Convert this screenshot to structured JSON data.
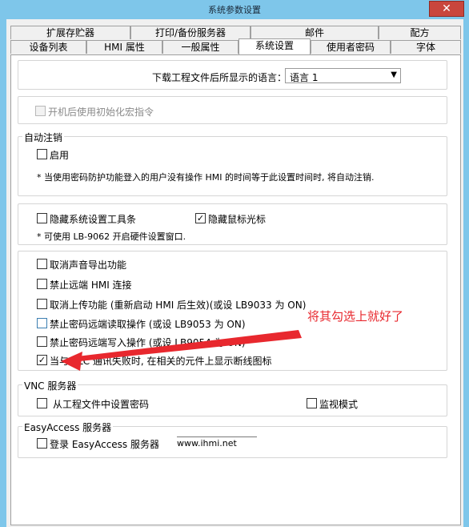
{
  "window": {
    "title": "系统参数设置",
    "close_label": "✕"
  },
  "tabs_row1": [
    {
      "label": "扩展存贮器"
    },
    {
      "label": "打印/备份服务器"
    },
    {
      "label": "邮件"
    },
    {
      "label": "配方"
    }
  ],
  "tabs_row2": [
    {
      "label": "设备列表"
    },
    {
      "label": "HMI 属性"
    },
    {
      "label": "一般属性"
    },
    {
      "label": "系统设置",
      "active": true
    },
    {
      "label": "使用者密码"
    },
    {
      "label": "字体"
    }
  ],
  "language": {
    "label": "下载工程文件后所显示的语言：",
    "selected": "语言 1"
  },
  "startup_macro": {
    "label": "开机后使用初始化宏指令",
    "checked": false,
    "enabled": false
  },
  "auto_logout": {
    "group_label": "自动注销",
    "enable_label": "启用",
    "enable_checked": false,
    "note": "* 当使用密码防护功能登入的用户没有操作 HMI 的时间等于此设置时间时, 将自动注销."
  },
  "toolbar_group": {
    "hide_toolbar_label": "隐藏系统设置工具条",
    "hide_toolbar_checked": false,
    "hide_cursor_label": "隐藏鼠标光标",
    "hide_cursor_checked": true,
    "note": "* 可使用 LB-9062 开启硬件设置窗口."
  },
  "options": [
    {
      "label": "取消声音导出功能",
      "checked": false
    },
    {
      "label": "禁止远端 HMI 连接",
      "checked": false
    },
    {
      "label": "取消上传功能 (重新启动 HMI 后生效)(或设 LB9033 为 ON)",
      "checked": false
    },
    {
      "label": "禁止密码远端读取操作 (或设 LB9053 为 ON)",
      "checked": false
    },
    {
      "label": "禁止密码远端写入操作 (或设 LB9054 为 ON)",
      "checked": false
    },
    {
      "label": "当与 PLC 通讯失败时, 在相关的元件上显示断线图标",
      "checked": true
    }
  ],
  "vnc": {
    "group_label": "VNC 服务器",
    "password_label": "从工程文件中设置密码",
    "password_checked": false,
    "monitor_label": "监视模式",
    "monitor_checked": false
  },
  "easyaccess": {
    "group_label": "EasyAccess 服务器",
    "login_label": "登录 EasyAccess 服务器",
    "login_checked": false,
    "url": "www.ihmi.net"
  },
  "annotation": {
    "text": "将其勾选上就好了",
    "color": "#e8282e"
  }
}
